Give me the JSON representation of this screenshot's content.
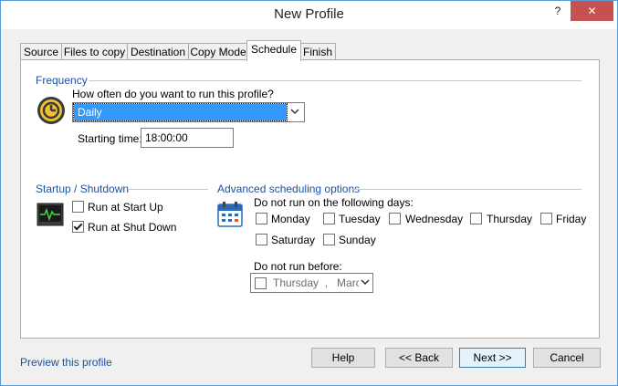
{
  "window": {
    "title": "New Profile",
    "help_glyph": "?",
    "close_glyph": "✕"
  },
  "tabs": [
    {
      "label": "Source"
    },
    {
      "label": "Files to copy"
    },
    {
      "label": "Destination"
    },
    {
      "label": "Copy Mode"
    },
    {
      "label": "Schedule"
    },
    {
      "label": "Finish"
    }
  ],
  "frequency": {
    "group_label": "Frequency",
    "question": "How often do you want to run this profile?",
    "selected": "Daily",
    "starting_time_label": "Starting time:",
    "starting_time_value": "18:00:00"
  },
  "startup": {
    "group_label": "Startup / Shutdown",
    "run_at_startup": {
      "label": "Run at Start Up",
      "checked": false
    },
    "run_at_shutdown": {
      "label": "Run at Shut Down",
      "checked": true
    }
  },
  "advanced": {
    "group_label": "Advanced scheduling options",
    "days_label": "Do not run on the following days:",
    "days": [
      {
        "label": "Monday",
        "checked": false
      },
      {
        "label": "Tuesday",
        "checked": false
      },
      {
        "label": "Wednesday",
        "checked": false
      },
      {
        "label": "Thursday",
        "checked": false
      },
      {
        "label": "Friday",
        "checked": false
      },
      {
        "label": "Saturday",
        "checked": false
      },
      {
        "label": "Sunday",
        "checked": false
      }
    ],
    "not_before_label": "Do not run before:",
    "not_before_value": "Thursday  ,   Marc"
  },
  "footer": {
    "preview_link": "Preview this profile",
    "help_button": "Help",
    "back_button": "<< Back",
    "next_button": "Next >>",
    "cancel_button": "Cancel"
  },
  "colors": {
    "accent": "#1e50a0",
    "selection": "#3399ff",
    "close": "#c75050"
  }
}
